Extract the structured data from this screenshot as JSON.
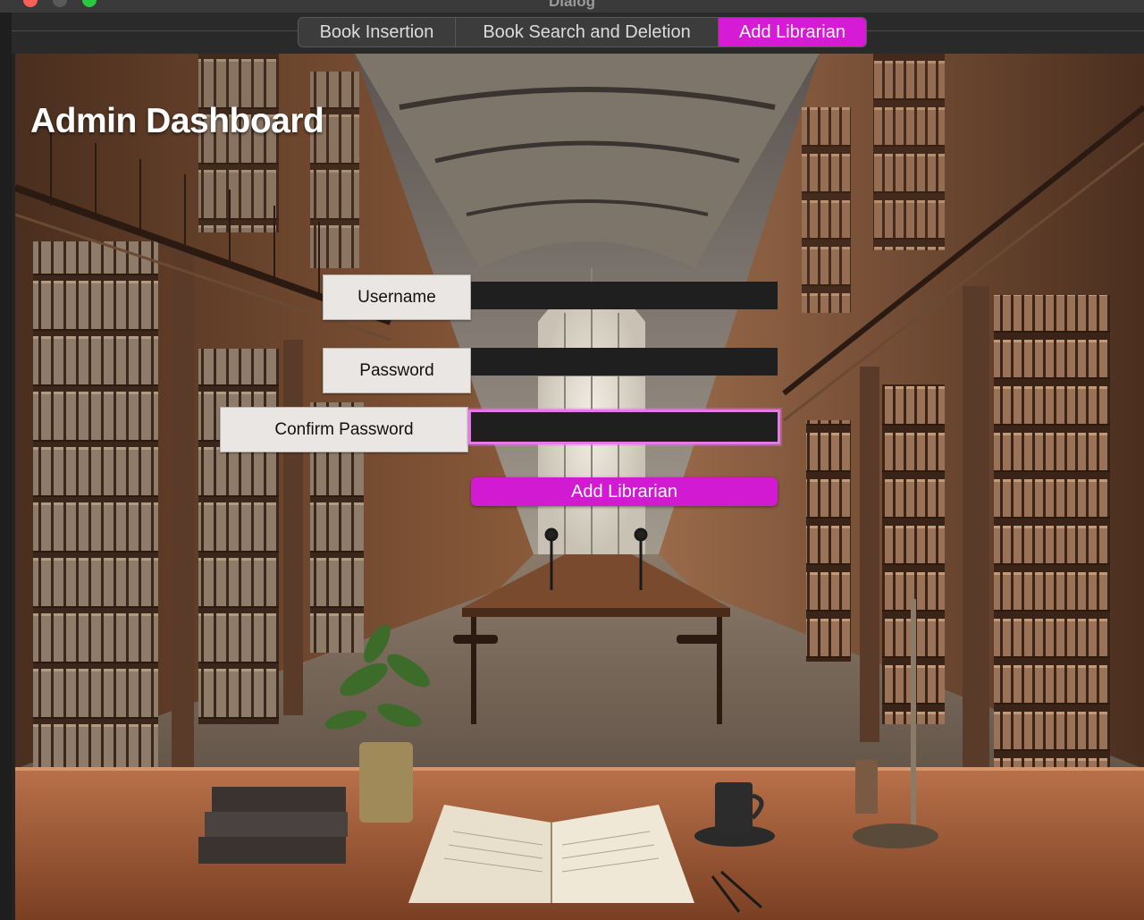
{
  "window": {
    "title": "Dialog"
  },
  "tabs": [
    {
      "label": "Book Insertion",
      "active": false
    },
    {
      "label": "Book Search and Deletion",
      "active": false
    },
    {
      "label": "Add Librarian",
      "active": true
    }
  ],
  "page": {
    "title": "Admin Dashboard"
  },
  "form": {
    "username_label": "Username",
    "username_value": "",
    "password_label": "Password",
    "password_value": "",
    "confirm_label": "Confirm Password",
    "confirm_value": "",
    "submit_label": "Add Librarian"
  },
  "colors": {
    "accent": "#d21ad2",
    "input_bg": "#1f1f1f"
  }
}
